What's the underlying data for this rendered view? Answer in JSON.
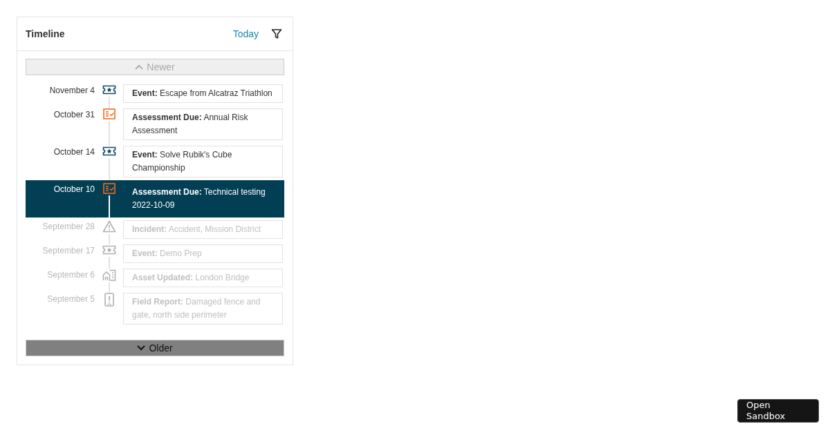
{
  "panel": {
    "title": "Timeline",
    "today_link": "Today"
  },
  "newer_button": {
    "label": "Newer",
    "disabled": true
  },
  "items": [
    {
      "date": "November 4",
      "kind": "event",
      "type": "Event:",
      "text": "Escape from Alcatraz Triathlon",
      "selected": false,
      "dimmed": false
    },
    {
      "date": "October 31",
      "kind": "assessment",
      "type": "Assessment Due:",
      "text": "Annual Risk Assessment",
      "selected": false,
      "dimmed": false
    },
    {
      "date": "October 14",
      "kind": "event",
      "type": "Event:",
      "text": "Solve Rubik's Cube Championship",
      "selected": false,
      "dimmed": false
    },
    {
      "date": "October 10",
      "kind": "assessment",
      "type": "Assessment Due:",
      "text": "Technical testing 2022-10-09",
      "selected": true,
      "dimmed": false
    },
    {
      "date": "September 28",
      "kind": "incident",
      "type": "Incident:",
      "text": "Accident, Mission District",
      "selected": false,
      "dimmed": true
    },
    {
      "date": "September 17",
      "kind": "event",
      "type": "Event:",
      "text": "Demo Prep",
      "selected": false,
      "dimmed": true
    },
    {
      "date": "September 6",
      "kind": "asset",
      "type": "Asset Updated:",
      "text": "London Bridge",
      "selected": false,
      "dimmed": true
    },
    {
      "date": "September 5",
      "kind": "report",
      "type": "Field Report:",
      "text": "Damaged fence and gate, north side perimeter",
      "selected": false,
      "dimmed": true
    }
  ],
  "older_button": {
    "label": "Older",
    "disabled": false
  },
  "sandbox_button": {
    "label": "Open Sandbox"
  }
}
